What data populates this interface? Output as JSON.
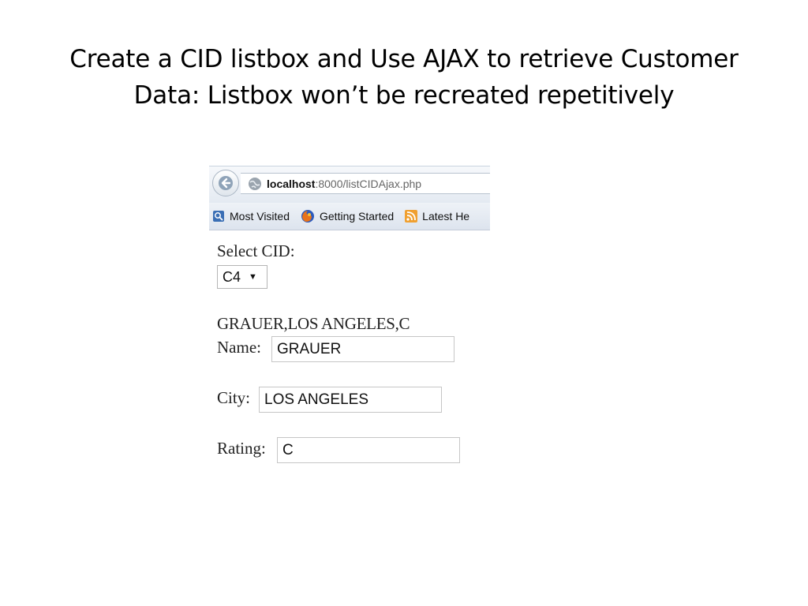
{
  "slide": {
    "title_line1": "Create a CID listbox and Use AJAX to retrieve Customer",
    "title_line2": "Data: Listbox won’t be recreated repetitively"
  },
  "browser": {
    "url_host": "localhost",
    "url_path": ":8000/listCIDAjax.php",
    "bookmarks": [
      {
        "label": "Most Visited",
        "icon": "bookmark-page-icon"
      },
      {
        "label": "Getting Started",
        "icon": "firefox-icon"
      },
      {
        "label": "Latest He",
        "icon": "rss-icon"
      }
    ]
  },
  "page": {
    "select_label": "Select CID:",
    "selected_cid": "C4",
    "result_text": "GRAUER,LOS ANGELES,C",
    "name_label": "Name:",
    "name_value": "GRAUER",
    "city_label": "City:",
    "city_value": "LOS ANGELES",
    "rating_label": "Rating:",
    "rating_value": "C"
  },
  "colors": {
    "toolbar": "#e4eaf2",
    "field_border": "#c6c6c6"
  }
}
